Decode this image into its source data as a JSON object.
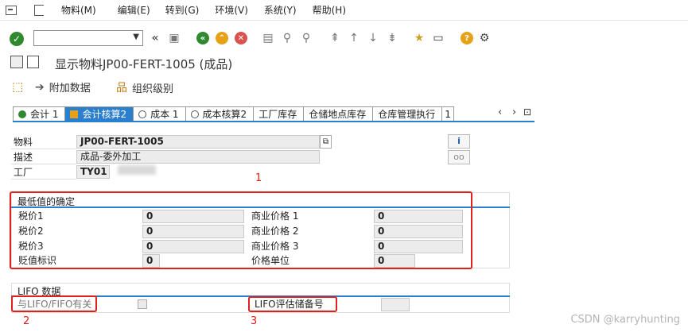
{
  "menubar": {
    "items": [
      "物料(M)",
      "编辑(E)",
      "转到(G)",
      "环境(V)",
      "系统(Y)",
      "帮助(H)"
    ]
  },
  "toolbar": {
    "icons": [
      "enter-icon",
      "back-icon",
      "exit-icon",
      "cancel-icon",
      "print-icon",
      "find-icon",
      "find-next-icon",
      "first-page-icon",
      "prev-page-icon",
      "next-page-icon",
      "last-page-icon",
      "new-session-icon",
      "shortcut-icon",
      "help-icon",
      "settings-icon"
    ],
    "command_value": ""
  },
  "title": {
    "text": "显示物料JP00-FERT-1005 (成品)"
  },
  "subtools": {
    "additional_data": "附加数据",
    "org_levels": "组织级别"
  },
  "tabs": [
    {
      "label": "会计 1",
      "active": false
    },
    {
      "label": "会计核算2",
      "active": true
    },
    {
      "label": "成本 1",
      "active": false
    },
    {
      "label": "成本核算2",
      "active": false
    },
    {
      "label": "工厂库存",
      "active": false
    },
    {
      "label": "仓储地点库存",
      "active": false
    },
    {
      "label": "仓库管理执行",
      "active": false
    },
    {
      "label": "1",
      "active": false
    }
  ],
  "header": {
    "material_label": "物料",
    "material_value": "JP00-FERT-1005",
    "desc_label": "描述",
    "desc_value": "成品-委外加工",
    "plant_label": "工厂",
    "plant_value": "TY01"
  },
  "lowest_value": {
    "title": "最低值的确定",
    "tax1_label": "税价1",
    "tax1_value": "0",
    "tax2_label": "税价2",
    "tax2_value": "0",
    "tax3_label": "税价3",
    "tax3_value": "0",
    "dev_label": "贬值标识",
    "dev_value": "0",
    "com1_label": "商业价格 1",
    "com1_value": "0",
    "com2_label": "商业价格 2",
    "com2_value": "0",
    "com3_label": "商业价格 3",
    "com3_value": "0",
    "unit_label": "价格单位",
    "unit_value": "0"
  },
  "lifo": {
    "title": "LIFO 数据",
    "relevant_label": "与LIFO/FIFO有关",
    "pool_label": "LIFO评估储备号",
    "pool_value": ""
  },
  "annotations": {
    "n1": "1",
    "n2": "2",
    "n3": "3"
  },
  "watermark": "CSDN @karryhunting",
  "colors": {
    "accent": "#2a7fcf",
    "highlight": "#e0211b",
    "field_bg": "#ececec"
  }
}
